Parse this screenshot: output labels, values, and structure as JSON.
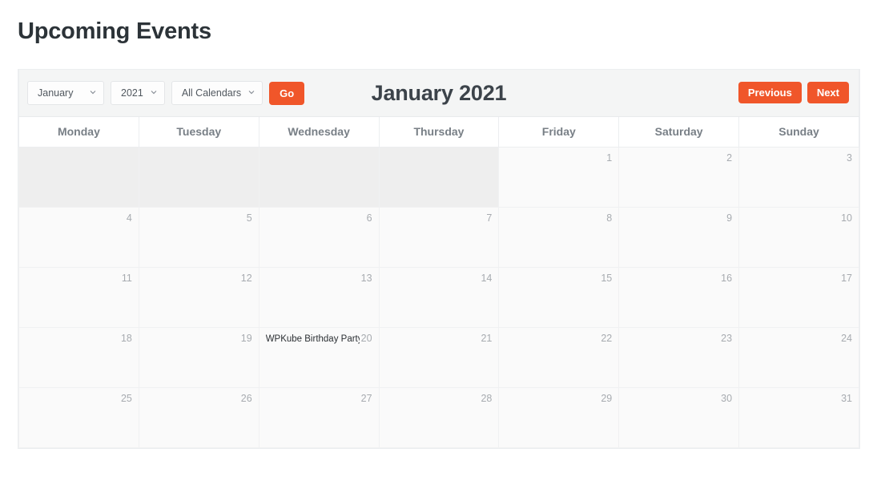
{
  "page": {
    "title": "Upcoming Events"
  },
  "toolbar": {
    "month_select": {
      "value": "January"
    },
    "year_select": {
      "value": "2021"
    },
    "calendar_select": {
      "value": "All Calendars"
    },
    "go_label": "Go",
    "current_period": "January 2021",
    "previous_label": "Previous",
    "next_label": "Next"
  },
  "theme": {
    "accent": "#f0562a",
    "title_color": "#2c3338",
    "day_number_color": "#a7abb0",
    "weekday_header_color": "#787f86",
    "toolbar_background": "#f4f5f5",
    "cell_background": "#fafafa",
    "padding_cell_background": "#eeeeee"
  },
  "calendar": {
    "weekday_headers": [
      "Monday",
      "Tuesday",
      "Wednesday",
      "Thursday",
      "Friday",
      "Saturday",
      "Sunday"
    ],
    "weeks": [
      [
        {
          "day": "",
          "blank": true
        },
        {
          "day": "",
          "blank": true
        },
        {
          "day": "",
          "blank": true
        },
        {
          "day": "",
          "blank": true
        },
        {
          "day": "1",
          "blank": false,
          "events": []
        },
        {
          "day": "2",
          "blank": false,
          "events": []
        },
        {
          "day": "3",
          "blank": false,
          "events": []
        }
      ],
      [
        {
          "day": "4",
          "blank": false,
          "events": []
        },
        {
          "day": "5",
          "blank": false,
          "events": []
        },
        {
          "day": "6",
          "blank": false,
          "events": []
        },
        {
          "day": "7",
          "blank": false,
          "events": []
        },
        {
          "day": "8",
          "blank": false,
          "events": []
        },
        {
          "day": "9",
          "blank": false,
          "events": []
        },
        {
          "day": "10",
          "blank": false,
          "events": []
        }
      ],
      [
        {
          "day": "11",
          "blank": false,
          "events": []
        },
        {
          "day": "12",
          "blank": false,
          "events": []
        },
        {
          "day": "13",
          "blank": false,
          "events": []
        },
        {
          "day": "14",
          "blank": false,
          "events": []
        },
        {
          "day": "15",
          "blank": false,
          "events": []
        },
        {
          "day": "16",
          "blank": false,
          "events": []
        },
        {
          "day": "17",
          "blank": false,
          "events": []
        }
      ],
      [
        {
          "day": "18",
          "blank": false,
          "events": []
        },
        {
          "day": "19",
          "blank": false,
          "events": []
        },
        {
          "day": "20",
          "blank": false,
          "events": [
            "WPKube Birthday Party"
          ]
        },
        {
          "day": "21",
          "blank": false,
          "events": []
        },
        {
          "day": "22",
          "blank": false,
          "events": []
        },
        {
          "day": "23",
          "blank": false,
          "events": []
        },
        {
          "day": "24",
          "blank": false,
          "events": []
        }
      ],
      [
        {
          "day": "25",
          "blank": false,
          "events": []
        },
        {
          "day": "26",
          "blank": false,
          "events": []
        },
        {
          "day": "27",
          "blank": false,
          "events": []
        },
        {
          "day": "28",
          "blank": false,
          "events": []
        },
        {
          "day": "29",
          "blank": false,
          "events": []
        },
        {
          "day": "30",
          "blank": false,
          "events": []
        },
        {
          "day": "31",
          "blank": false,
          "events": []
        }
      ]
    ]
  }
}
